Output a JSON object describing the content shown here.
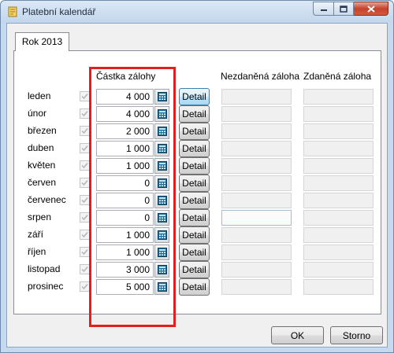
{
  "window": {
    "title": "Platební kalendář",
    "accent_color": "#c6d9ee",
    "highlight_color": "#e02020"
  },
  "tabs": [
    {
      "label": "Rok 2013",
      "selected": true
    }
  ],
  "columns": {
    "amount": "Částka zálohy",
    "untaxed": "Nezdaněná záloha",
    "taxed": "Zdaněná záloha"
  },
  "rows": [
    {
      "month": "leden",
      "checked": true,
      "amount": "4 000",
      "detail": "Detail"
    },
    {
      "month": "únor",
      "checked": true,
      "amount": "4 000",
      "detail": "Detail"
    },
    {
      "month": "březen",
      "checked": true,
      "amount": "2 000",
      "detail": "Detail"
    },
    {
      "month": "duben",
      "checked": true,
      "amount": "1 000",
      "detail": "Detail"
    },
    {
      "month": "květen",
      "checked": true,
      "amount": "1 000",
      "detail": "Detail"
    },
    {
      "month": "červen",
      "checked": true,
      "amount": "0",
      "detail": "Detail"
    },
    {
      "month": "červenec",
      "checked": true,
      "amount": "0",
      "detail": "Detail"
    },
    {
      "month": "srpen",
      "checked": true,
      "amount": "0",
      "detail": "Detail"
    },
    {
      "month": "září",
      "checked": true,
      "amount": "1 000",
      "detail": "Detail"
    },
    {
      "month": "říjen",
      "checked": true,
      "amount": "1 000",
      "detail": "Detail"
    },
    {
      "month": "listopad",
      "checked": true,
      "amount": "3 000",
      "detail": "Detail"
    },
    {
      "month": "prosinec",
      "checked": true,
      "amount": "5 000",
      "detail": "Detail"
    }
  ],
  "footer": {
    "ok_label": "OK",
    "cancel_label": "Storno"
  }
}
